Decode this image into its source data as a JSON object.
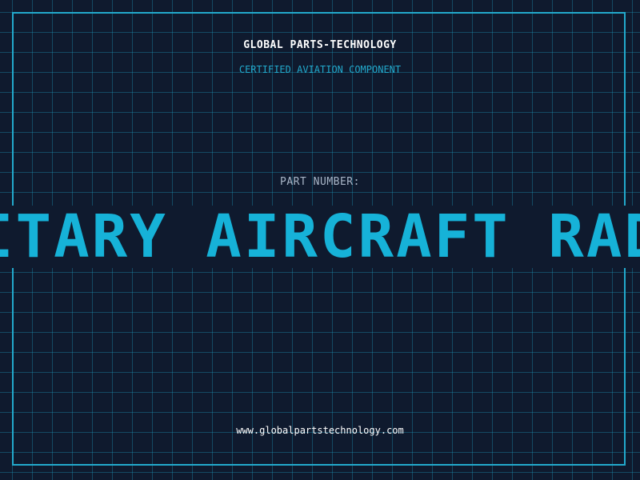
{
  "header": {
    "company": "GLOBAL PARTS-TECHNOLOGY",
    "tagline": "CERTIFIED AVIATION COMPONENT"
  },
  "part": {
    "label": "PART NUMBER:",
    "value": "ITARY AIRCRAFT RAD"
  },
  "footer": {
    "website": "www.globalpartstechnology.com"
  },
  "colors": {
    "background": "#0f1a2e",
    "accent": "#22a9cc",
    "part_number": "#16b2d8",
    "label": "#a9b6c8",
    "text": "#ffffff"
  }
}
